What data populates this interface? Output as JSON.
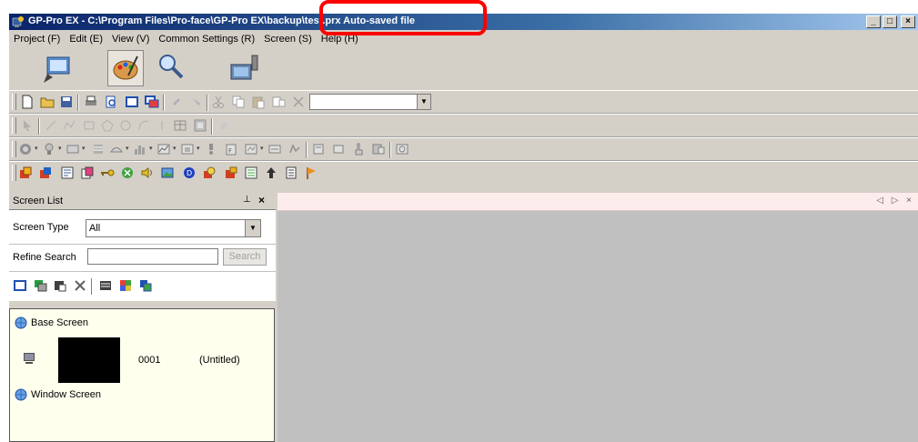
{
  "window": {
    "title": "GP-Pro EX - C:\\Program Files\\Pro-face\\GP-Pro EX\\backup\\test.prx Auto-saved file",
    "controls": {
      "minimize": "_",
      "maximize": "□",
      "close": "×"
    }
  },
  "menu": [
    "Project (F)",
    "Edit (E)",
    "View (V)",
    "Common Settings (R)",
    "Screen (S)",
    "Help (H)"
  ],
  "big_toolbar": [
    {
      "name": "project-icon"
    },
    {
      "name": "palette-screen-icon",
      "active": true
    },
    {
      "name": "search-screen-icon"
    },
    {
      "name": "transfer-device-icon"
    }
  ],
  "toolbar_combo_value": "",
  "screen_list_panel": {
    "title": "Screen List",
    "pin": "⊥",
    "close": "×",
    "screen_type_label": "Screen Type",
    "screen_type_value": "All",
    "refine_search_label": "Refine Search",
    "search_value": "",
    "search_button": "Search",
    "categories": [
      {
        "label": "Base Screen"
      },
      {
        "label": "Window Screen"
      }
    ],
    "screens": [
      {
        "number": "0001",
        "name": "(Untitled)"
      }
    ]
  },
  "workarea": {
    "tab_controls": "◁ ▷ ×"
  },
  "colors": {
    "title_start": "#0a246a",
    "title_end": "#a6caf0",
    "face": "#d4d0c8",
    "list_bg": "#ffffee",
    "workarea_tab_bg": "#fdecec",
    "highlight": "#ff0000"
  }
}
